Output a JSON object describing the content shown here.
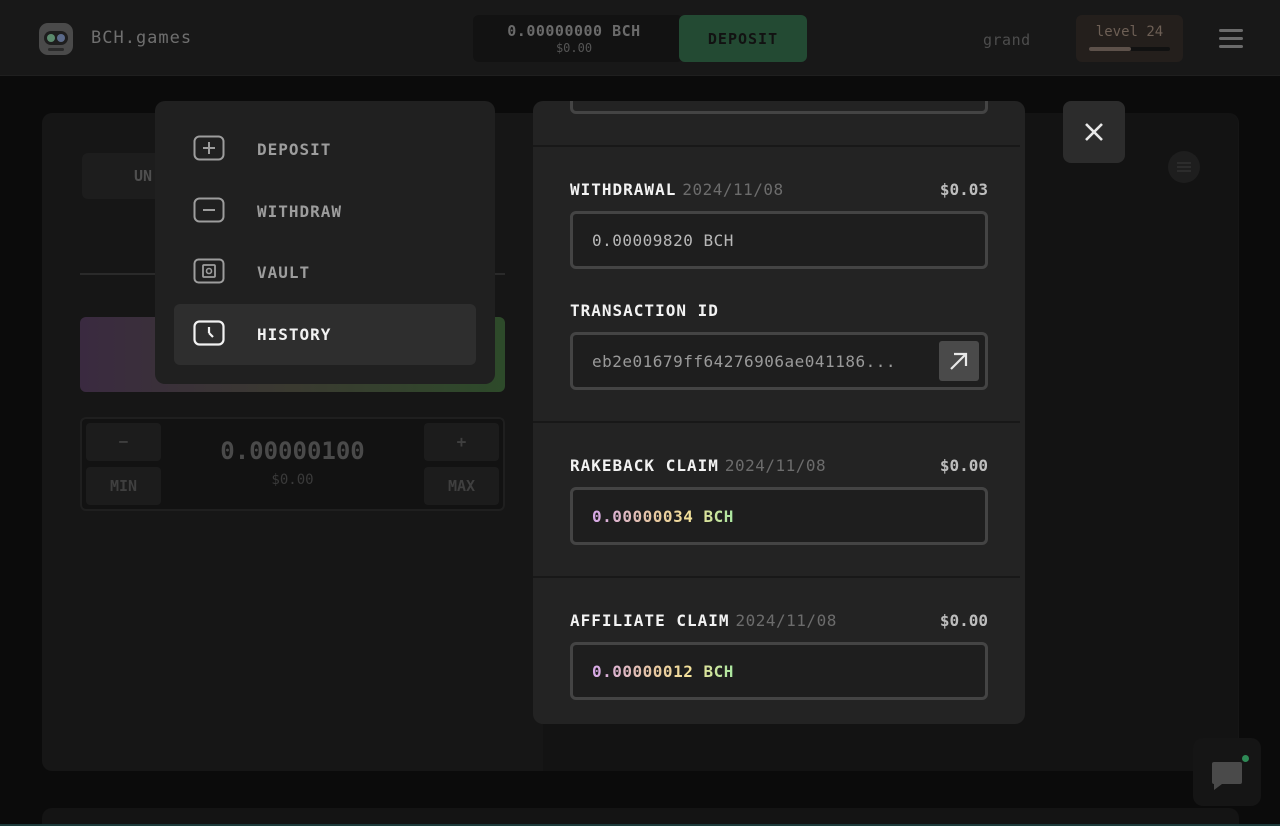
{
  "header": {
    "logo_text": "BCH.games",
    "balance": "0.00000000 BCH",
    "balance_usd": "$0.00",
    "deposit_label": "DEPOSIT",
    "username": "grand",
    "level_label": "level 24",
    "level_progress": 0.52
  },
  "background": {
    "tab_label": "UN",
    "bet_amount": "0.00000100",
    "bet_amount_usd": "$0.00",
    "minus": "−",
    "plus": "+",
    "min_label": "MIN",
    "max_label": "MAX"
  },
  "wallet_menu": {
    "items": [
      {
        "label": "DEPOSIT",
        "icon": "plus-box-icon"
      },
      {
        "label": "WITHDRAW",
        "icon": "minus-box-icon"
      },
      {
        "label": "VAULT",
        "icon": "vault-icon"
      },
      {
        "label": "HISTORY",
        "icon": "clock-icon",
        "active": true
      }
    ]
  },
  "history": {
    "entries": [
      {
        "type": "WITHDRAWAL",
        "date": "2024/11/08",
        "usd": "$0.03",
        "amount": "0.00009820 BCH",
        "txid_label": "TRANSACTION ID",
        "txid": "eb2e01679ff64276906ae041186..."
      },
      {
        "type": "RAKEBACK CLAIM",
        "date": "2024/11/08",
        "usd": "$0.00",
        "amount": "0.00000034 BCH"
      },
      {
        "type": "AFFILIATE CLAIM",
        "date": "2024/11/08",
        "usd": "$0.00",
        "amount": "0.00000012 BCH"
      }
    ]
  },
  "colors": {
    "accent_green": "#2e8a56",
    "panel_bg": "#232323",
    "page_bg": "#0b0b0b"
  }
}
